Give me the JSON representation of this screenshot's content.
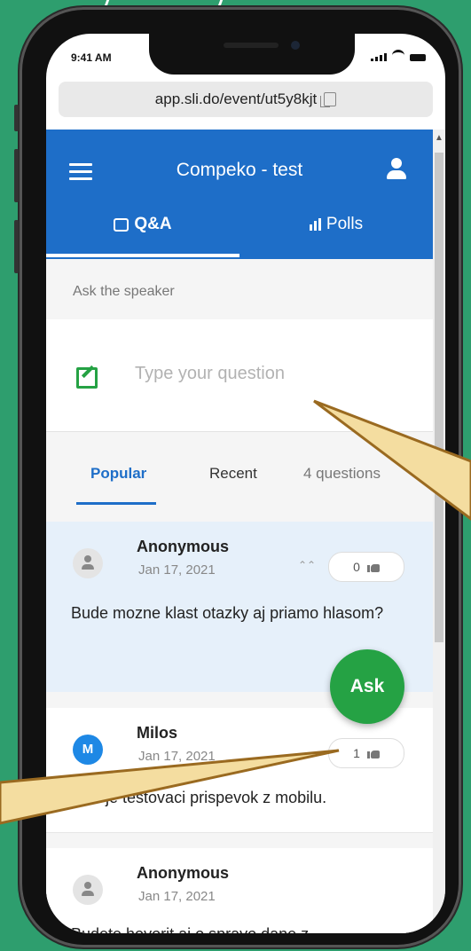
{
  "status_bar": {
    "time": "9:41 AM"
  },
  "browser": {
    "url": "app.sli.do/event/ut5y8kjt"
  },
  "header": {
    "title": "Compeko - test",
    "tabs": [
      {
        "label": "Q&A",
        "icon": "chat-icon",
        "active": true
      },
      {
        "label": "Polls",
        "icon": "bar-chart-icon",
        "active": false
      }
    ]
  },
  "ask_section": {
    "label": "Ask the speaker",
    "placeholder": "Type your question"
  },
  "question_tabs": {
    "popular": "Popular",
    "recent": "Recent",
    "count": "4 questions"
  },
  "questions": [
    {
      "author": "Anonymous",
      "date": "Jan 17, 2021",
      "likes": "0",
      "text": "Bude mozne klast otazky aj priamo hlasom?",
      "more": "•••"
    },
    {
      "author": "Milos",
      "date": "Jan 17, 2021",
      "likes": "1",
      "text": "Toto je testovaci prispevok z mobilu.",
      "avatar_letter": "M"
    },
    {
      "author": "Anonymous",
      "date": "Jan 17, 2021",
      "text": "Budete hovorit aj o spravo dane z"
    }
  ],
  "ask_button": "Ask",
  "colors": {
    "header": "#1e6ec8",
    "accent_green": "#25a244",
    "background": "#2e9e6e"
  }
}
